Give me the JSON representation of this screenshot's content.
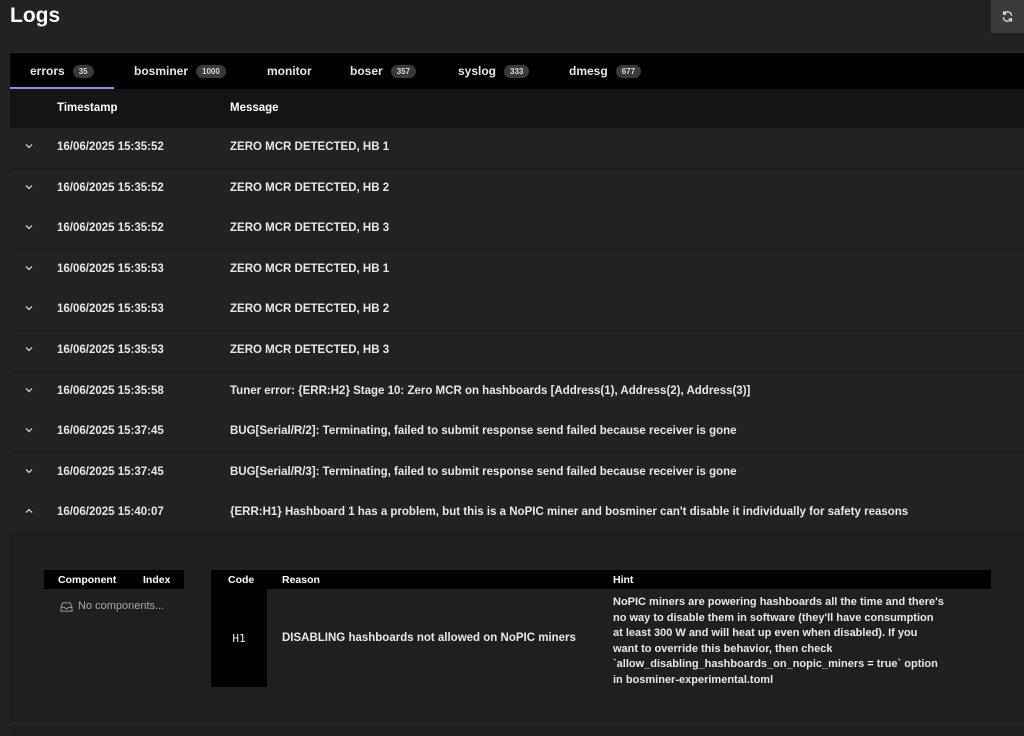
{
  "page": {
    "title": "Logs"
  },
  "icons": {
    "refresh": "refresh-icon",
    "chevron_down": "chevron-down-icon",
    "chevron_up": "chevron-up-icon",
    "inbox": "inbox-icon"
  },
  "colors": {
    "tab_underline": "#8e8ef0",
    "background": "#222222",
    "header": "#000000"
  },
  "tabs": [
    {
      "label": "errors",
      "count": "35",
      "active": true
    },
    {
      "label": "bosminer",
      "count": "1000"
    },
    {
      "label": "monitor",
      "count": ""
    },
    {
      "label": "boser",
      "count": "357"
    },
    {
      "label": "syslog",
      "count": "333"
    },
    {
      "label": "dmesg",
      "count": "677"
    }
  ],
  "table": {
    "columns": {
      "timestamp": "Timestamp",
      "message": "Message"
    },
    "rows": [
      {
        "timestamp": "16/06/2025 15:35:52",
        "message": "ZERO MCR DETECTED, HB 1"
      },
      {
        "timestamp": "16/06/2025 15:35:52",
        "message": "ZERO MCR DETECTED, HB 2"
      },
      {
        "timestamp": "16/06/2025 15:35:52",
        "message": "ZERO MCR DETECTED, HB 3"
      },
      {
        "timestamp": "16/06/2025 15:35:53",
        "message": "ZERO MCR DETECTED, HB 1"
      },
      {
        "timestamp": "16/06/2025 15:35:53",
        "message": "ZERO MCR DETECTED, HB 2"
      },
      {
        "timestamp": "16/06/2025 15:35:53",
        "message": "ZERO MCR DETECTED, HB 3"
      },
      {
        "timestamp": "16/06/2025 15:35:58",
        "message": "Tuner error: {ERR:H2} Stage 10: Zero MCR on hashboards [Address(1), Address(2), Address(3)]"
      },
      {
        "timestamp": "16/06/2025 15:37:45",
        "message": "BUG[Serial/R/2]: Terminating, failed to submit response send failed because receiver is gone"
      },
      {
        "timestamp": "16/06/2025 15:37:45",
        "message": "BUG[Serial/R/3]: Terminating, failed to submit response send failed because receiver is gone"
      },
      {
        "timestamp": "16/06/2025 15:40:07",
        "message": "{ERR:H1} Hashboard 1 has a problem, but this is a NoPIC miner and bosminer can't disable it individually for safety reasons",
        "expanded": true
      }
    ]
  },
  "detail": {
    "components": {
      "col_component": "Component",
      "col_index": "Index",
      "empty": "No components..."
    },
    "errors": {
      "col_code": "Code",
      "col_reason": "Reason",
      "col_hint": "Hint",
      "code": "H1",
      "reason": "DISABLING hashboards not allowed on NoPIC miners",
      "hint_lines": [
        "NoPIC miners are powering hashboards all the time and there's",
        "no way to disable them in software (they'll have consumption",
        "at least 300 W and will heat up even when disabled). If you",
        "want to override this behavior, then check",
        "`allow_disabling_hashboards_on_nopic_miners = true` option",
        "in bosminer-experimental.toml"
      ]
    }
  }
}
